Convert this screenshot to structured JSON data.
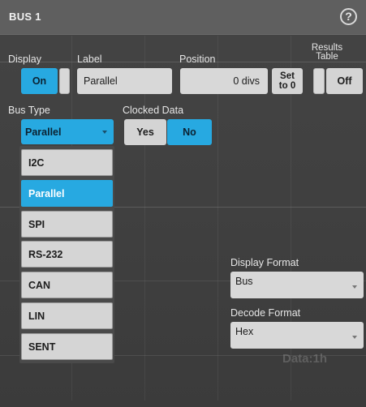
{
  "window": {
    "title": "BUS 1"
  },
  "display": {
    "label": "Display",
    "value": "On"
  },
  "label_field": {
    "label": "Label",
    "value": "Parallel"
  },
  "position": {
    "label": "Position",
    "value": "0 divs",
    "set_button": "Set\nto 0"
  },
  "results_table": {
    "label": "Results\nTable",
    "value": "Off"
  },
  "bus_type": {
    "label": "Bus Type",
    "selected": "Parallel",
    "options": [
      "I2C",
      "Parallel",
      "SPI",
      "RS-232",
      "CAN",
      "LIN",
      "SENT"
    ]
  },
  "clocked_data": {
    "label": "Clocked Data",
    "yes_label": "Yes",
    "no_label": "No",
    "selected": "No"
  },
  "display_format": {
    "label": "Display Format",
    "value": "Bus"
  },
  "decode_format": {
    "label": "Decode Format",
    "value": "Hex"
  },
  "background_readout": "Data:1h",
  "colors": {
    "accent": "#27a9e1",
    "panel": "#3f3f3f",
    "titlebar": "#5f5f5f",
    "control": "#d8d8d8"
  },
  "icons": {
    "help": "question-circle-icon",
    "dropdown": "chevron-down-icon"
  }
}
